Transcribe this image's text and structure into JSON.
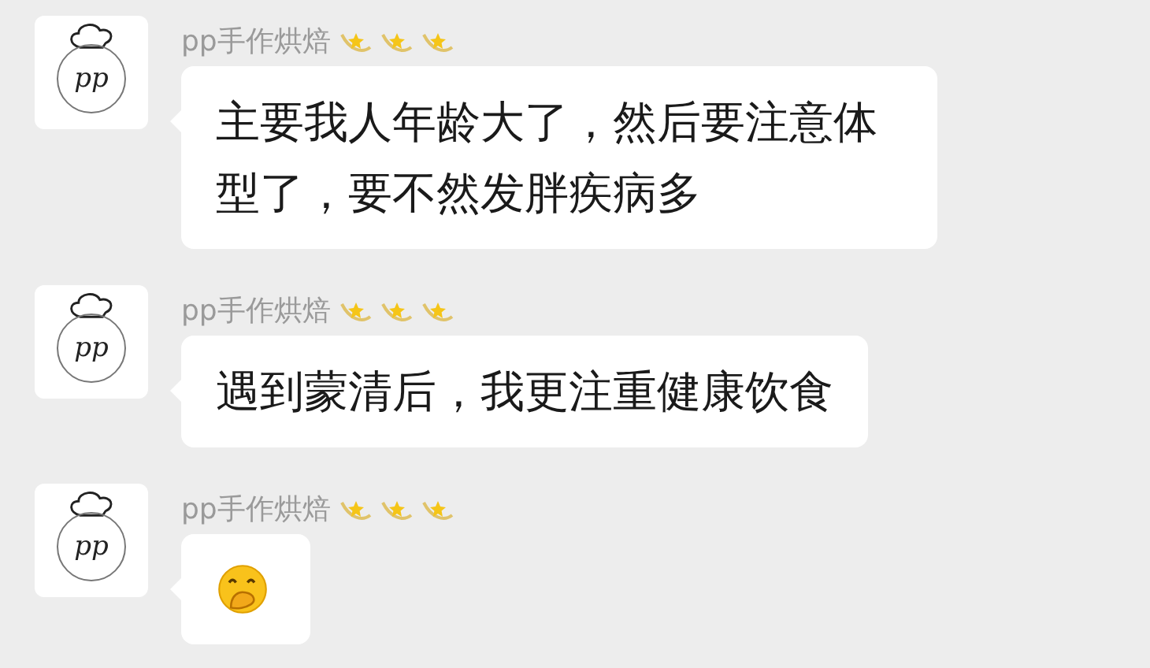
{
  "messages": [
    {
      "sender": "pp手作烘焙",
      "avatar_text": "pp",
      "badges": [
        {
          "kind": "shooting-star"
        },
        {
          "kind": "shooting-star"
        },
        {
          "kind": "shooting-star"
        }
      ],
      "kind": "text",
      "text": "主要我人年龄大了，然后要注意体型了，要不然发胖疾病多"
    },
    {
      "sender": "pp手作烘焙",
      "avatar_text": "pp",
      "badges": [
        {
          "kind": "shooting-star"
        },
        {
          "kind": "shooting-star"
        },
        {
          "kind": "shooting-star"
        }
      ],
      "kind": "text",
      "text": "遇到蒙清后，我更注重健康饮食"
    },
    {
      "sender": "pp手作烘焙",
      "avatar_text": "pp",
      "badges": [
        {
          "kind": "shooting-star"
        },
        {
          "kind": "shooting-star"
        },
        {
          "kind": "shooting-star"
        }
      ],
      "kind": "emoji"
    }
  ]
}
